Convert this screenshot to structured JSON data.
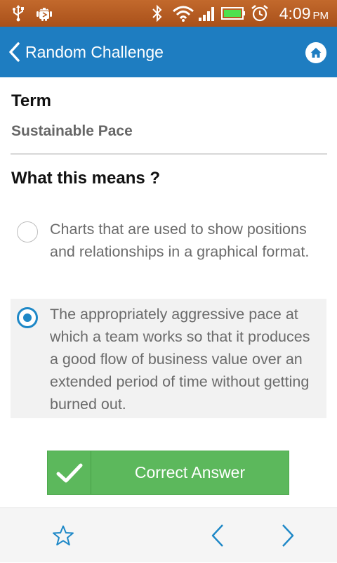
{
  "status_bar": {
    "time": "4:09",
    "ampm": "PM",
    "icons": [
      "usb-icon",
      "android-debug-icon",
      "bluetooth-icon",
      "wifi-icon",
      "signal-icon",
      "battery-icon",
      "alarm-icon"
    ]
  },
  "app_bar": {
    "title": "Random Challenge",
    "back_icon": "chevron-left-icon",
    "home_icon": "home-icon"
  },
  "term": {
    "heading": "Term",
    "value": "Sustainable Pace"
  },
  "question": {
    "heading": "What this means ?"
  },
  "options": [
    {
      "text": "Charts that are used to show positions and relationships in a graphical format.",
      "selected": false
    },
    {
      "text": "The appropriately aggressive pace at which a team works so that it produces a good flow of business value over an extended period of time without getting burned out.",
      "selected": true
    }
  ],
  "result": {
    "label": "Correct Answer",
    "icon": "checkmark-icon"
  },
  "bottom_bar": {
    "favorite_icon": "star-outline-icon",
    "prev_icon": "chevron-left-icon",
    "next_icon": "chevron-right-icon"
  },
  "colors": {
    "status_bar": "#b65a1f",
    "app_bar": "#1e7dc1",
    "accent": "#1e88c7",
    "success": "#5cb85c",
    "option_selected_bg": "#f2f2f2"
  }
}
